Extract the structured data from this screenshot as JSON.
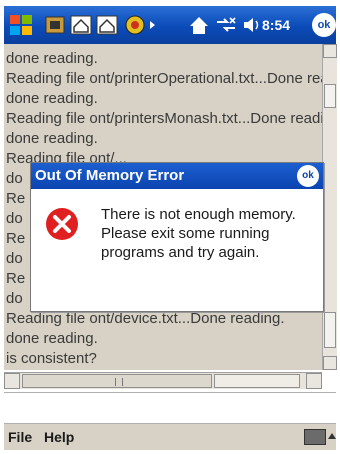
{
  "status_bar": {
    "time": "8:54",
    "ok_label": "ok"
  },
  "log_lines": [
    "done reading.",
    "Reading file ont/printerOperational.txt...Done reading.",
    "done reading.",
    "Reading file ont/printersMonash.txt...Done reading.",
    "done reading.",
    "Reading file ont/...",
    "do",
    "Re",
    "do",
    "Re",
    "do",
    "Re",
    "do",
    "Reading file ont/device.txt...Done reading.",
    "done reading.",
    "is consistent?"
  ],
  "dialog": {
    "title": "Out Of Memory Error",
    "ok_label": "ok",
    "message": "There is not enough memory. Please exit some running programs and try again."
  },
  "menu": {
    "file": "File",
    "help": "Help"
  },
  "colors": {
    "taskbar": "#0b4bb8",
    "text_bg": "#d8d2c6",
    "error_red": "#e02020"
  },
  "icons": [
    "windows-start-icon",
    "home-icon",
    "connectivity-icon",
    "volume-icon",
    "error-icon",
    "keyboard-icon"
  ]
}
